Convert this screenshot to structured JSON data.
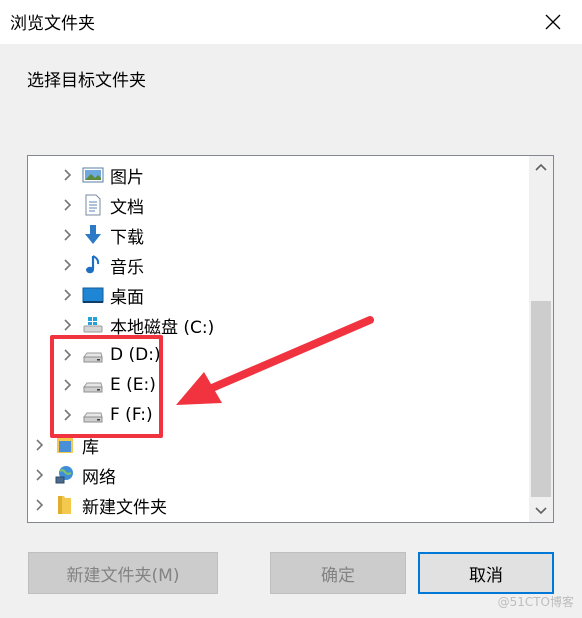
{
  "window": {
    "title": "浏览文件夹"
  },
  "prompt": "选择目标文件夹",
  "tree": {
    "items": [
      {
        "label": "图片",
        "icon": "pictures-icon"
      },
      {
        "label": "文档",
        "icon": "documents-icon"
      },
      {
        "label": "下载",
        "icon": "downloads-icon"
      },
      {
        "label": "音乐",
        "icon": "music-icon"
      },
      {
        "label": "桌面",
        "icon": "desktop-icon"
      },
      {
        "label": "本地磁盘 (C:)",
        "icon": "windows-drive-icon"
      },
      {
        "label": "D (D:)",
        "icon": "drive-icon"
      },
      {
        "label": "E (E:)",
        "icon": "drive-icon"
      },
      {
        "label": "F (F:)",
        "icon": "drive-icon"
      },
      {
        "label": "库",
        "icon": "library-icon"
      },
      {
        "label": "网络",
        "icon": "network-icon"
      },
      {
        "label": "新建文件夹",
        "icon": "folder-icon"
      }
    ]
  },
  "buttons": {
    "new_folder": "新建文件夹(M)",
    "ok": "确定",
    "cancel": "取消"
  },
  "colors": {
    "highlight": "#f0333f",
    "accent": "#0078d7"
  },
  "watermark": "@51CTO博客"
}
